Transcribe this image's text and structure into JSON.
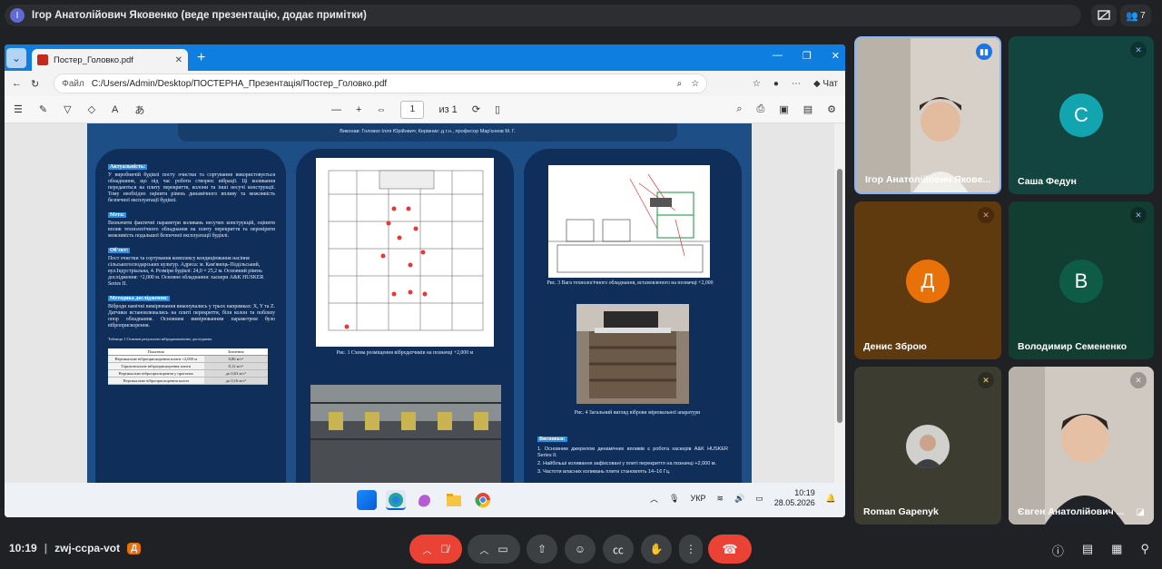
{
  "meet": {
    "presenter_initial": "І",
    "presenter_title": "Ігор Анатолійович Яковенко (веде презентацію, додає примітки)",
    "participants_count": "7",
    "time": "10:19",
    "meeting_code": "zwj-ccpa-vot",
    "host_badge": "Д"
  },
  "browser": {
    "tab_title": "Постер_Головко.pdf",
    "address_label": "Файл",
    "url": "C:/Users/Admin/Desktop/ПОСТЕРНА_Презентація/Постер_Головко.pdf",
    "chat_label": "Чат",
    "page_current": "1",
    "page_total": "из 1"
  },
  "poster": {
    "authors": "Виконав: Головко Ілля Юрійович; Керівник: д.т.н., професор Мар'єнков М. Г.",
    "col1": {
      "actual_h": "Актуальність:",
      "actual_p": "У виробничій будівлі посту очистки та сортування використовується обладнання, що під час роботи створює вібрації. Ці коливання передаються на плиту перекриття, колони та інші несучі конструкції. Тому необхідно оцінити рівень динамічного впливу та можливість безпечної експлуатації будівлі.",
      "goal_h": "Мета:",
      "goal_p": "Визначити фактичні параметри коливань несучих конструкцій, оцінити вплив технологічного обладнання на плиту перекриття та перевірити можливість подальшої безпечної експлуатації будівлі.",
      "object_h": "Об'єкт:",
      "object_p": "Пост очистки та сортування комплексу кондиціювання насіння сільськогосподарських культур. Адреса: м. Кам'янець-Подільський, вул.Індустріальна, 4. Розміри будівлі: 24,0 × 25,2 м. Основний рівень дослідження: +2,000 м. Основне обладнання: хаскери A&K HUSKER Series II.",
      "method_h": "Методика дослідження:",
      "method_p": "Віброди намічні вимірювання виконувались у трьох напрямках: X, Y та Z. Датчики встановлювались на плиті перекриття, біля колон та поблизу опор обладнання. Основним вимірюванням параметром було віброприскорення.",
      "table_caption": "Таблиця 1 Основні результати вібродинамічних досліджень",
      "table_head": [
        "Показник",
        "Значення"
      ],
      "table_rows": [
        [
          "Вертикальне віброприскорення плити +2,000 м",
          "0,86 м/с²"
        ],
        [
          "Горизонтальне віброприскорення плити",
          "0,12 м/с²"
        ],
        [
          "Вертикальне віброприскорення у прогонах",
          "до 0,63 м/с²"
        ],
        [
          "Вертикальне віброприскорення колон",
          "до 0,16 м/с²"
        ]
      ]
    },
    "fig1_caption": "Рис. 1 Схема розміщення вібродатчиків на позначці +2,000 м",
    "fig3_caption": "Рис. 3 Вага технологічного обладнання, встановленого на позначці +2,000",
    "fig4_caption": "Рис. 4 Загальний вигляд віброви мірювальної апаратури",
    "conclusions_h": "Висновки:",
    "conclusions": [
      "1. Основним джерелом динамічних впливів є робота хаскерів A&K HUSKER Series II.",
      "2. Найбільші коливання зафіксовані у плиті перекриття на позначці +2,000 м.",
      "3. Частоти власних коливань плити становлять 14–16 Гц."
    ]
  },
  "taskbar": {
    "lang": "УКР",
    "time": "10:19",
    "date": "28.05.2026"
  },
  "tiles": [
    {
      "name": "Ігор Анатолійович Яковенко",
      "display": "Ігор Анатолійович Якове...",
      "type": "video"
    },
    {
      "name": "Саша Федун",
      "initial": "С",
      "color": "#12a4af",
      "bg": "#12453f"
    },
    {
      "name": "Денис Зброю",
      "initial": "Д",
      "color": "#e8710a",
      "bg": "#5f3a0f"
    },
    {
      "name": "Володимир Семененко",
      "initial": "В",
      "color": "#0e5c45",
      "bg": "#123d31"
    },
    {
      "name": "Roman Gapenyk",
      "type": "photo",
      "bg": "#3c3c30"
    },
    {
      "name": "Євген Анатолійович",
      "display": "Євген Анатолійович ...",
      "type": "video"
    }
  ],
  "colors": {
    "meet_bg": "#202124",
    "end_call": "#ea4335",
    "mic_off": "#ea4335",
    "edge_blue": "#0e7fe0",
    "poster_blue": "#1d4e85"
  }
}
